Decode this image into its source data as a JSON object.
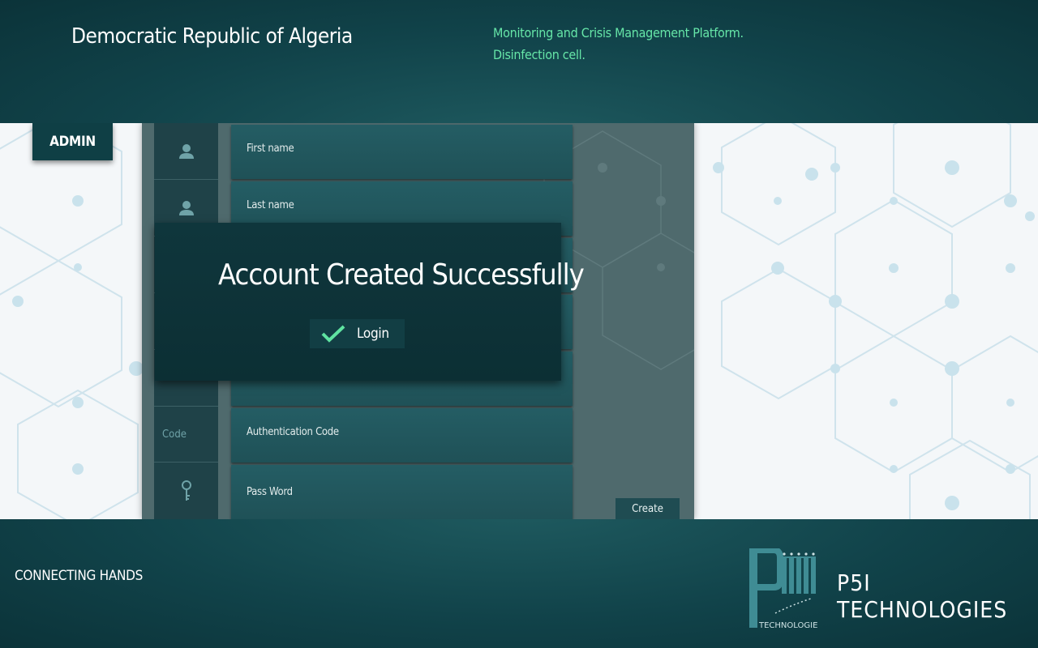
{
  "header": {
    "country_title": "Democratic Republic of Algeria",
    "platform_line1": "Monitoring and Crisis Management Platform.",
    "platform_line2": "Disinfection cell."
  },
  "sidebar": {
    "admin_label": "ADMIN"
  },
  "form": {
    "fields": [
      {
        "label": "First name",
        "icon": "user-icon"
      },
      {
        "label": "Last name",
        "icon": "user-icon"
      },
      {
        "label": "",
        "icon": ""
      },
      {
        "label": "",
        "icon": ""
      },
      {
        "label": "",
        "icon": ""
      },
      {
        "label": "Authentication Code",
        "icon_text": "Code"
      },
      {
        "label": "Pass Word",
        "icon": "key-icon"
      }
    ],
    "create_label": "Create"
  },
  "modal": {
    "title": "Account Created Successfully",
    "login_label": "Login",
    "login_icon": "checkmark-icon",
    "check_color": "#5fe3a1"
  },
  "footer": {
    "tagline": "CONNECTING HANDS",
    "company": "P5I TECHNOLOGIES",
    "logo_text": "TECHNOLOGIES",
    "logo_icon": "p5i-logo-icon"
  },
  "colors": {
    "accent": "#66e6a8",
    "dark_teal": "#0f3f45",
    "field_teal": "#245d64"
  }
}
